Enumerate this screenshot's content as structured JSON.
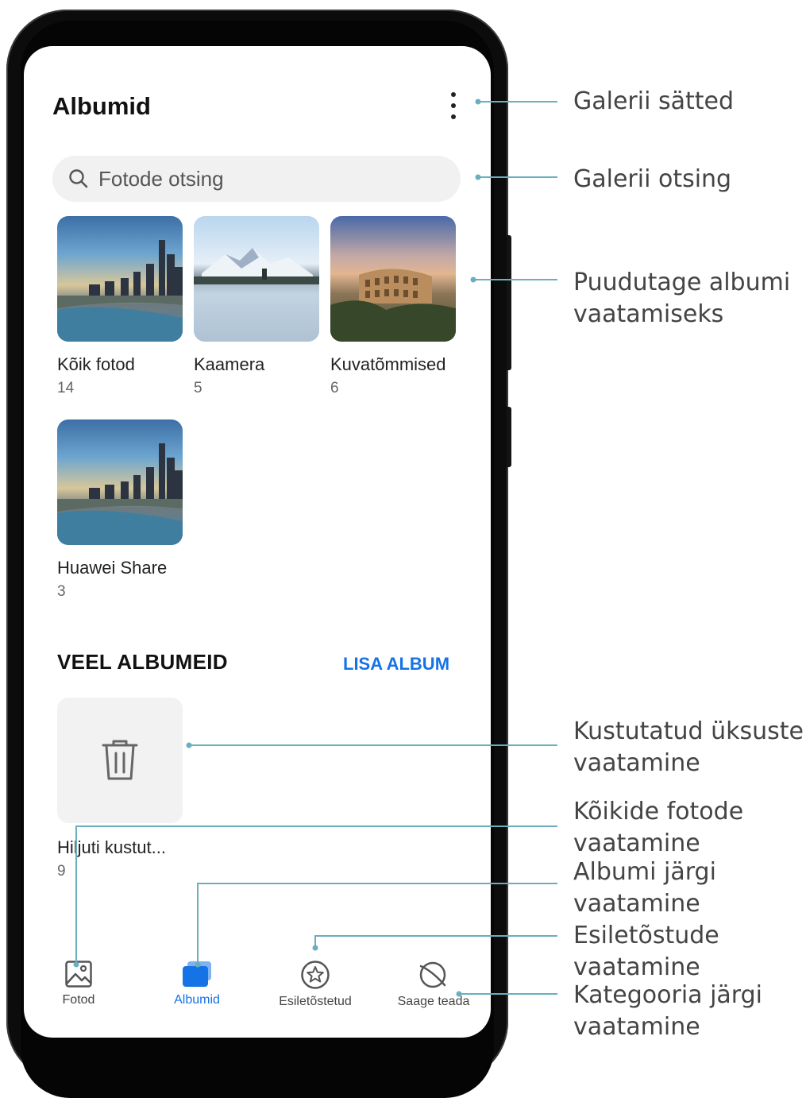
{
  "header": {
    "title": "Albumid"
  },
  "search": {
    "placeholder": "Fotode otsing"
  },
  "albums": [
    {
      "name": "Kõik fotod",
      "count": "14"
    },
    {
      "name": "Kaamera",
      "count": "5"
    },
    {
      "name": "Kuvatõmmised",
      "count": "6"
    },
    {
      "name": "Huawei Share",
      "count": "3"
    }
  ],
  "more_albums": {
    "title": "VEEL ALBUMEID",
    "add_label": "LISA ALBUM",
    "items": [
      {
        "name": "Hiljuti kustut...",
        "count": "9"
      }
    ]
  },
  "nav": {
    "items": [
      {
        "label": "Fotod"
      },
      {
        "label": "Albumid",
        "active": true
      },
      {
        "label": "Esiletõstetud"
      },
      {
        "label": "Saage teada"
      }
    ]
  },
  "callouts": [
    {
      "lines": [
        "Galerii sätted"
      ]
    },
    {
      "lines": [
        "Galerii otsing"
      ]
    },
    {
      "lines": [
        "Puudutage albumi",
        "vaatamiseks"
      ]
    },
    {
      "lines": [
        "Kustutatud üksuste",
        "vaatamine"
      ]
    },
    {
      "lines": [
        "Kõikide fotode",
        "vaatamine"
      ]
    },
    {
      "lines": [
        "Albumi järgi",
        "vaatamine"
      ]
    },
    {
      "lines": [
        "Esiletõstude",
        "vaatamine"
      ]
    },
    {
      "lines": [
        "Kategooria järgi",
        "vaatamine"
      ]
    }
  ],
  "colors": {
    "accent": "#1573e6",
    "callout_line": "#6aaec0",
    "phone_body": "#0c0c0d"
  }
}
